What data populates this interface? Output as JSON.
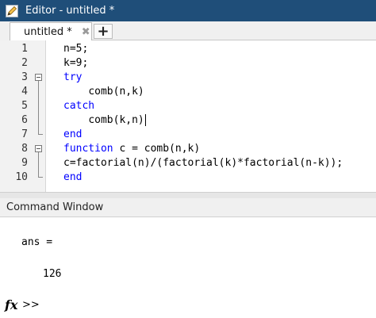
{
  "window": {
    "title": "Editor - untitled *"
  },
  "tabs": [
    {
      "label": "untitled *",
      "close_icon": "✖"
    }
  ],
  "add_tab_label": "+",
  "editor": {
    "line_numbers": [
      "1",
      "2",
      "3",
      "4",
      "5",
      "6",
      "7",
      "8",
      "9",
      "10"
    ],
    "lines": [
      {
        "indent": "",
        "keyword": "",
        "text": "n=5;"
      },
      {
        "indent": "",
        "keyword": "",
        "text": "k=9;"
      },
      {
        "indent": "",
        "keyword": "try",
        "text": ""
      },
      {
        "indent": "    ",
        "keyword": "",
        "text": "comb(n,k)"
      },
      {
        "indent": "",
        "keyword": "catch",
        "text": ""
      },
      {
        "indent": "    ",
        "keyword": "",
        "text": "comb(k,n)"
      },
      {
        "indent": "",
        "keyword": "end",
        "text": ""
      },
      {
        "indent": "",
        "keyword": "function",
        "text": " c = comb(n,k)"
      },
      {
        "indent": "",
        "keyword": "",
        "text": "c=factorial(n)/(factorial(k)*factorial(n-k));"
      },
      {
        "indent": "",
        "keyword": "end",
        "text": ""
      }
    ]
  },
  "command_window": {
    "title": "Command Window",
    "output": [
      "ans =",
      "126"
    ],
    "prompt_fx": "fx",
    "prompt": ">>"
  },
  "colors": {
    "titlebar": "#1f4e79",
    "keyword": "#0000ff"
  }
}
